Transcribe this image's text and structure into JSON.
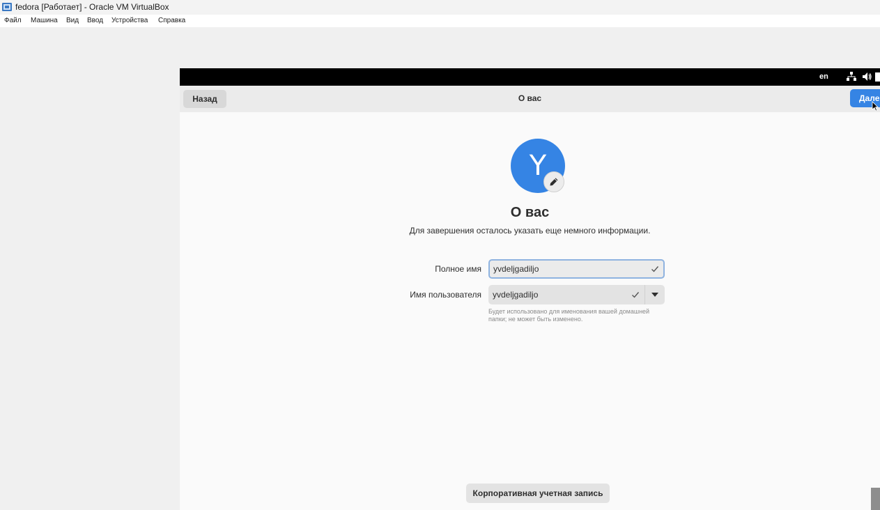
{
  "window": {
    "title": "fedora [Работает] - Oracle VM VirtualBox",
    "icon": "virtualbox-icon"
  },
  "menu": [
    "Файл",
    "Машина",
    "Вид",
    "Ввод",
    "Устройства",
    "Справка"
  ],
  "guest": {
    "topbar": {
      "language": "en",
      "icons": [
        "network-icon",
        "volume-icon",
        "power-icon"
      ]
    },
    "header": {
      "back_label": "Назад",
      "title": "О вас",
      "next_label": "Дале"
    },
    "avatar": {
      "initial": "Y",
      "color": "#3584e4",
      "edit_icon": "pencil-icon"
    },
    "heading": "О вас",
    "description": "Для завершения осталось указать еще немного информации.",
    "form": {
      "fullname_label": "Полное имя",
      "fullname_value": "yvdeljgadiljo",
      "username_label": "Имя пользователя",
      "username_value": "yvdeljgadiljo",
      "hint": "Будет использовано для именования вашей домашней папки; не может быть изменено."
    },
    "enterprise_label": "Корпоративная учетная запись"
  },
  "colors": {
    "accent": "#3584e4",
    "header_bg": "#ebebeb",
    "page_bg": "#fafafa"
  }
}
